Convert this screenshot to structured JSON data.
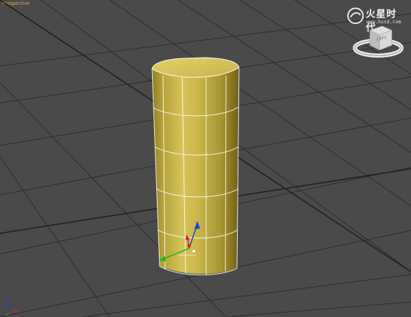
{
  "viewport": {
    "label": "Perspective",
    "background": "#4a4a4a",
    "grid_color": "#2a2a2a",
    "grid_major_color": "#1e1e1e"
  },
  "object": {
    "type": "cylinder",
    "color": "#c9b545",
    "edge_color": "#ffffff",
    "sides": 12,
    "height_segments": 5
  },
  "gizmo": {
    "x_color": "#16b81c",
    "y_color": "#d82020",
    "z_color": "#1a3ce0"
  },
  "watermark": {
    "text": "火星时代",
    "url": "www.hxsd.com"
  },
  "viewcube": {
    "face_label": "LEFT"
  },
  "icons": [
    "viewcube-icon",
    "transform-gizmo-icon",
    "axis-tripod-icon",
    "watermark-logo-icon"
  ]
}
